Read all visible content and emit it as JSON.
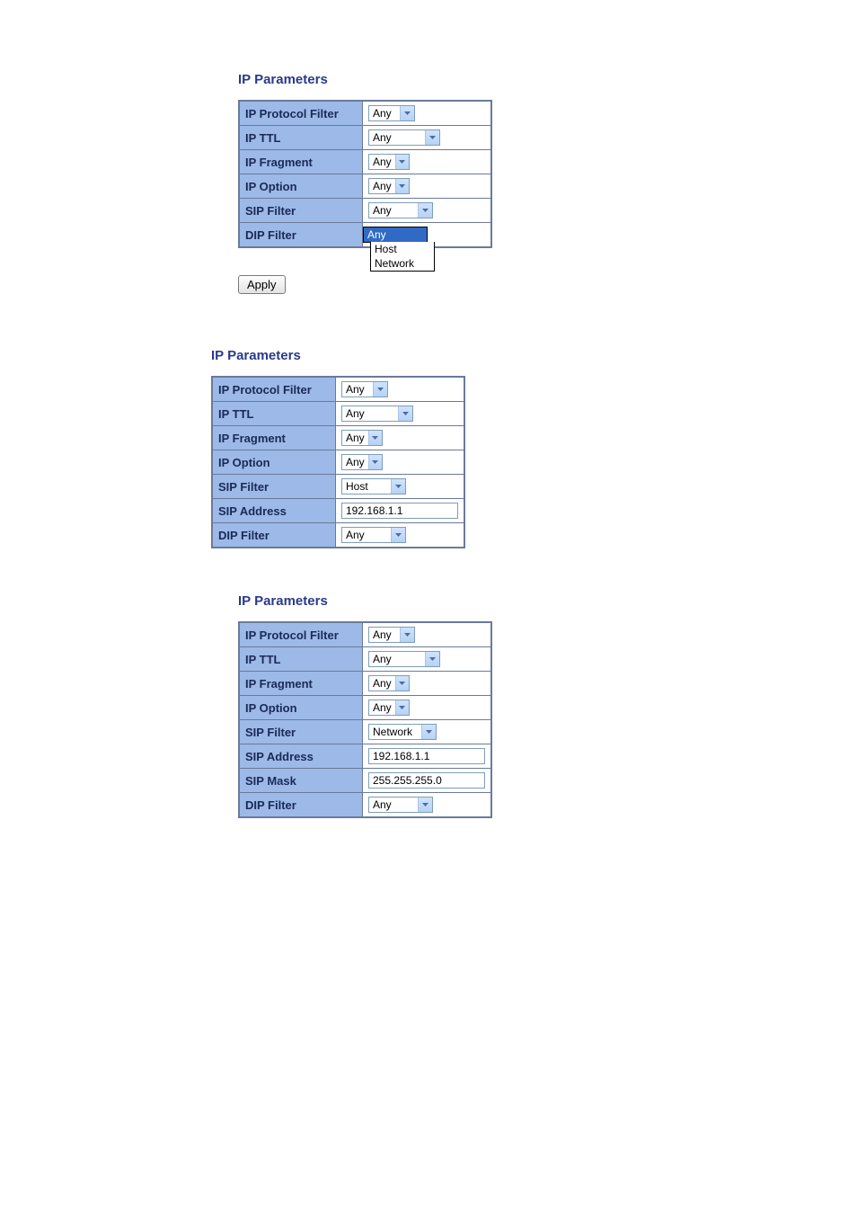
{
  "section1": {
    "title": "IP Parameters",
    "rows": {
      "ip_protocol_filter": {
        "label": "IP Protocol Filter",
        "value": "Any"
      },
      "ip_ttl": {
        "label": "IP TTL",
        "value": "Any"
      },
      "ip_fragment": {
        "label": "IP Fragment",
        "value": "Any"
      },
      "ip_option": {
        "label": "IP Option",
        "value": "Any"
      },
      "sip_filter": {
        "label": "SIP Filter",
        "value": "Any"
      },
      "dip_filter": {
        "label": "DIP Filter",
        "value": "Any"
      }
    },
    "dip_open_options": [
      "Any",
      "Host",
      "Network"
    ],
    "dip_open_selected": "Any",
    "apply_label": "Apply"
  },
  "section2": {
    "title": "IP Parameters",
    "rows": {
      "ip_protocol_filter": {
        "label": "IP Protocol Filter",
        "value": "Any"
      },
      "ip_ttl": {
        "label": "IP TTL",
        "value": "Any"
      },
      "ip_fragment": {
        "label": "IP Fragment",
        "value": "Any"
      },
      "ip_option": {
        "label": "IP Option",
        "value": "Any"
      },
      "sip_filter": {
        "label": "SIP Filter",
        "value": "Host"
      },
      "sip_address": {
        "label": "SIP Address",
        "value": "192.168.1.1"
      },
      "dip_filter": {
        "label": "DIP Filter",
        "value": "Any"
      }
    }
  },
  "section3": {
    "title": "IP Parameters",
    "rows": {
      "ip_protocol_filter": {
        "label": "IP Protocol Filter",
        "value": "Any"
      },
      "ip_ttl": {
        "label": "IP TTL",
        "value": "Any"
      },
      "ip_fragment": {
        "label": "IP Fragment",
        "value": "Any"
      },
      "ip_option": {
        "label": "IP Option",
        "value": "Any"
      },
      "sip_filter": {
        "label": "SIP Filter",
        "value": "Network"
      },
      "sip_address": {
        "label": "SIP Address",
        "value": "192.168.1.1"
      },
      "sip_mask": {
        "label": "SIP Mask",
        "value": "255.255.255.0"
      },
      "dip_filter": {
        "label": "DIP Filter",
        "value": "Any"
      }
    }
  }
}
